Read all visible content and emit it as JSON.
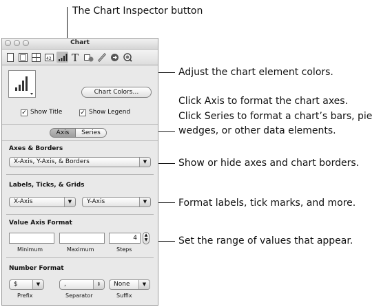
{
  "callouts": {
    "inspector_button": "The Chart Inspector button",
    "colors": "Adjust the chart element colors.",
    "axis_series_1": "Click Axis to format the chart axes.",
    "axis_series_2": "Click Series to format a chart’s bars, pie",
    "axis_series_3": "wedges, or other data elements.",
    "axes_borders": "Show or hide axes and chart borders.",
    "labels": "Format labels, tick marks, and more.",
    "range": "Set the range of values that appear."
  },
  "window": {
    "title": "Chart",
    "chart_colors_button": "Chart Colors…",
    "show_title": "Show Title",
    "show_legend": "Show Legend",
    "show_title_checked": true,
    "show_legend_checked": true,
    "tabs": [
      "Axis",
      "Series"
    ],
    "selected_tab": "Axis",
    "axes_borders": {
      "heading": "Axes & Borders",
      "value": "X-Axis, Y-Axis, & Borders"
    },
    "labels": {
      "heading": "Labels, Ticks, & Grids",
      "x": "X-Axis",
      "y": "Y-Axis"
    },
    "value_axis": {
      "heading": "Value Axis Format",
      "minimum": "",
      "maximum": "",
      "steps": "4",
      "minimum_label": "Minimum",
      "maximum_label": "Maximum",
      "steps_label": "Steps"
    },
    "number_format": {
      "heading": "Number Format",
      "prefix": "$",
      "separator": ",",
      "suffix": "None",
      "prefix_label": "Prefix",
      "separator_label": "Separator",
      "suffix_label": "Suffix"
    }
  },
  "toolbar_icons": [
    "document-icon",
    "layout-icon",
    "table-icon",
    "metrics-icon",
    "chart-icon",
    "text-icon",
    "graphic-icon",
    "ruler-icon",
    "link-icon",
    "quicktime-icon"
  ]
}
